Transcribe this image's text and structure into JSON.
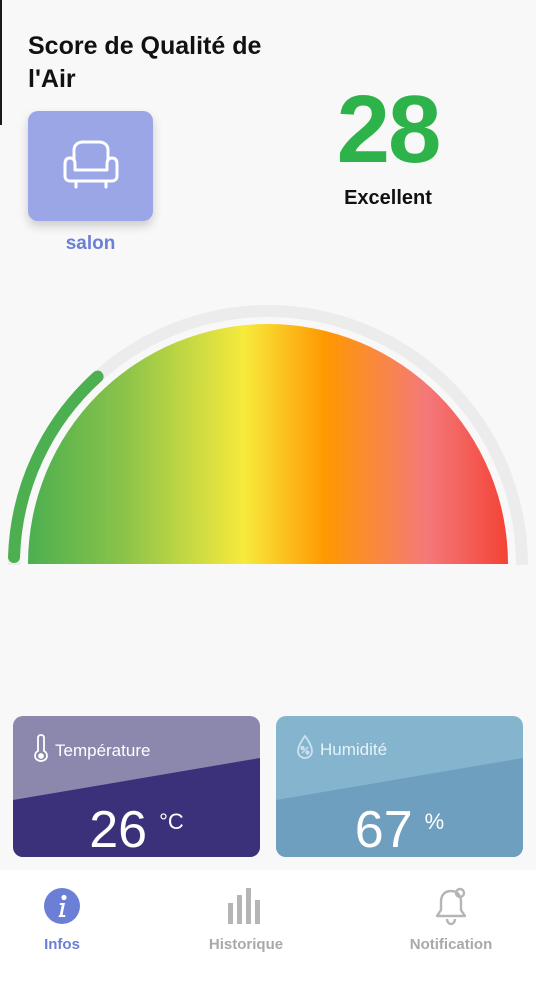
{
  "header": {
    "title": "Score de Qualité de l'Air"
  },
  "room": {
    "name": "salon",
    "icon": "armchair-icon",
    "tile_color": "#9aa6e6"
  },
  "score": {
    "value": "28",
    "label": "Excellent",
    "color": "#2db34a"
  },
  "gauge": {
    "level": 28,
    "max": 100,
    "indicator_color": "#4caf50"
  },
  "cards": {
    "temperature": {
      "label": "Température",
      "value": "26",
      "unit": "°C",
      "icon": "thermometer-icon"
    },
    "humidity": {
      "label": "Humidité",
      "value": "67",
      "unit": "%",
      "icon": "humidity-drop-icon"
    }
  },
  "nav": {
    "items": [
      {
        "label": "Infos",
        "icon": "info-icon",
        "active": true
      },
      {
        "label": "Historique",
        "icon": "bar-chart-icon",
        "active": false
      },
      {
        "label": "Notification",
        "icon": "bell-icon",
        "active": false
      }
    ]
  }
}
